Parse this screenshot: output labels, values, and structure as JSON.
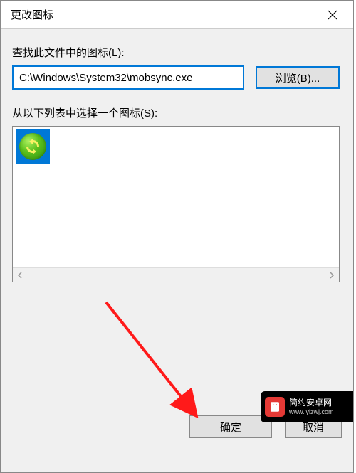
{
  "titlebar": {
    "title": "更改图标"
  },
  "labels": {
    "lookIn": "查找此文件中的图标(L):",
    "selectFrom": "从以下列表中选择一个图标(S):"
  },
  "inputs": {
    "path": "C:\\Windows\\System32\\mobsync.exe"
  },
  "buttons": {
    "browse": "浏览(B)...",
    "ok": "确定",
    "cancel": "取消"
  },
  "icons": {
    "list": [
      {
        "name": "sync-icon"
      }
    ]
  },
  "watermark": {
    "title": "简约安卓网",
    "url": "www.jylzwj.com"
  }
}
